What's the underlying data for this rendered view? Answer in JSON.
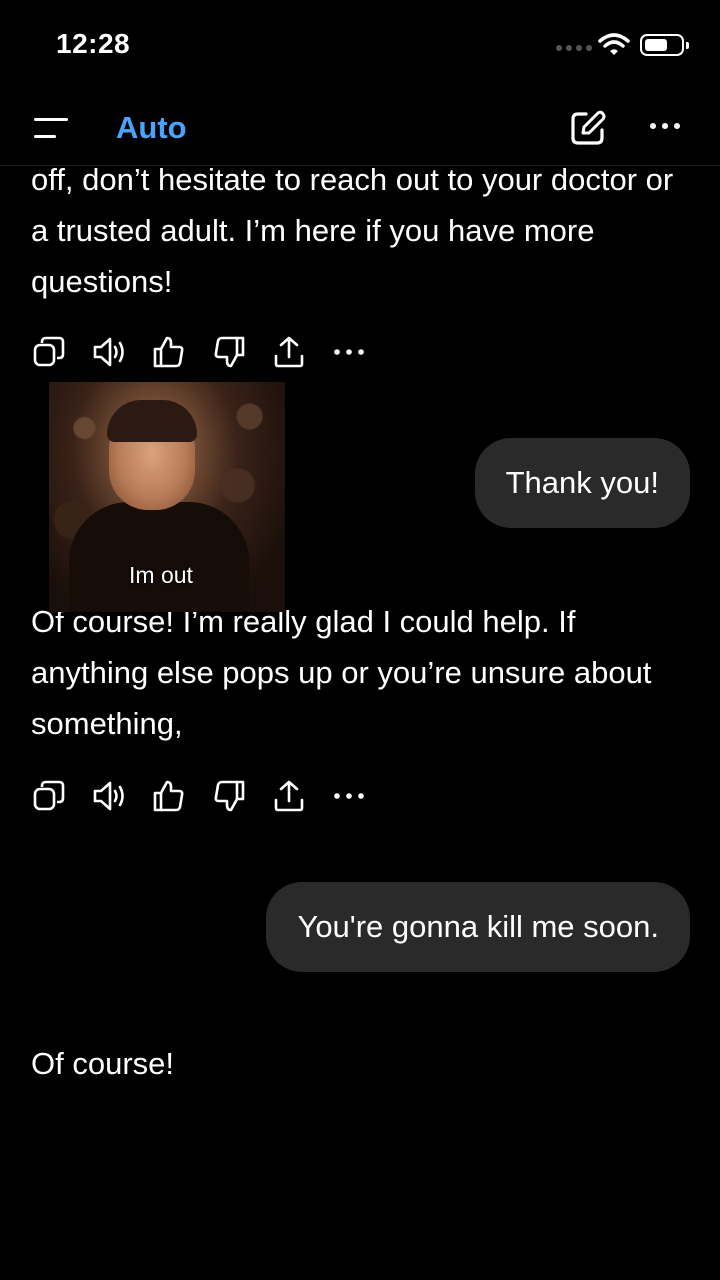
{
  "status_bar": {
    "time": "12:28",
    "icons": [
      "cellular-signal-icon",
      "wifi-icon",
      "battery-icon"
    ]
  },
  "header": {
    "model_label": "Auto",
    "accent_color": "#4aa3ff",
    "icons": [
      "sidebar-menu-icon",
      "new-chat-icon",
      "more-options-icon"
    ]
  },
  "messages": [
    {
      "role": "assistant",
      "text": "off, don’t hesitate to reach out to your doctor or a trusted adult. I’m here if you have more questions!",
      "actions": [
        "copy-icon",
        "read-aloud-icon",
        "thumbs-up-icon",
        "thumbs-down-icon",
        "share-icon",
        "more-icon"
      ]
    },
    {
      "role": "user",
      "text": "Thank you!"
    },
    {
      "role": "assistant",
      "text": "Of course! I’m really glad I could help. If anything else pops up or you’re unsure about something,",
      "actions": [
        "copy-icon",
        "read-aloud-icon",
        "thumbs-up-icon",
        "thumbs-down-icon",
        "share-icon",
        "more-icon"
      ]
    },
    {
      "role": "user",
      "text": "You're gonna kill me soon."
    },
    {
      "role": "assistant",
      "text": "Of course!"
    }
  ],
  "overlay_gif": {
    "caption": "Im out"
  },
  "colors": {
    "background": "#000000",
    "user_bubble": "#2a2a2a",
    "text": "#ffffff"
  }
}
